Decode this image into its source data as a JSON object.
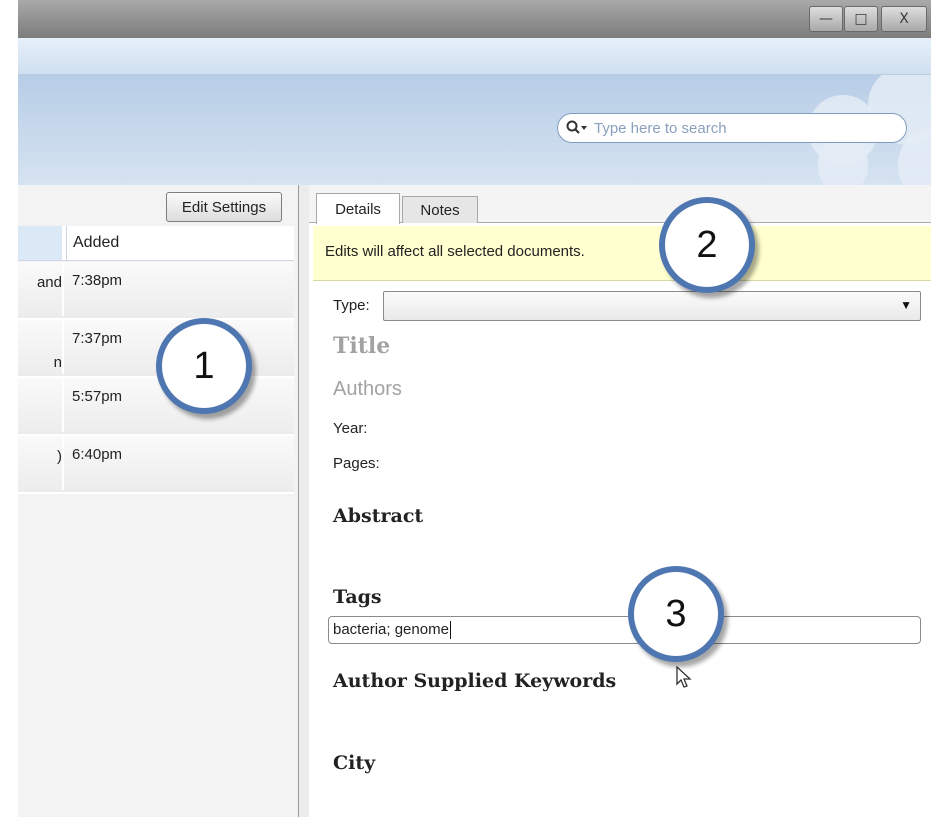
{
  "window": {
    "controls": {
      "minimize": "—",
      "restore": "□",
      "close": "X"
    }
  },
  "search": {
    "placeholder": "Type here to search",
    "icon": "search-icon"
  },
  "left_panel": {
    "edit_settings_label": "Edit Settings",
    "column_header": "Added",
    "rows": [
      {
        "fragment": "and",
        "time": "7:38pm"
      },
      {
        "fragment": "n",
        "time": "7:37pm"
      },
      {
        "fragment": "",
        "time": "5:57pm"
      },
      {
        "fragment": ")",
        "time": "6:40pm"
      }
    ]
  },
  "right_panel": {
    "tabs": [
      {
        "label": "Details",
        "active": true
      },
      {
        "label": "Notes",
        "active": false
      }
    ],
    "notice": "Edits will affect all selected documents.",
    "type_label": "Type:",
    "type_value": "",
    "title_placeholder": "Title",
    "authors_placeholder": "Authors",
    "year_label": "Year:",
    "pages_label": "Pages:",
    "abstract_heading": "Abstract",
    "tags_heading": "Tags",
    "tags_value": "bacteria; genome",
    "keywords_heading": "Author Supplied Keywords",
    "city_heading": "City"
  },
  "callouts": [
    "1",
    "2",
    "3"
  ],
  "colors": {
    "callout_border": "#4e76b1",
    "notice_bg": "#ffffcf",
    "banner": "#b7cde6"
  }
}
